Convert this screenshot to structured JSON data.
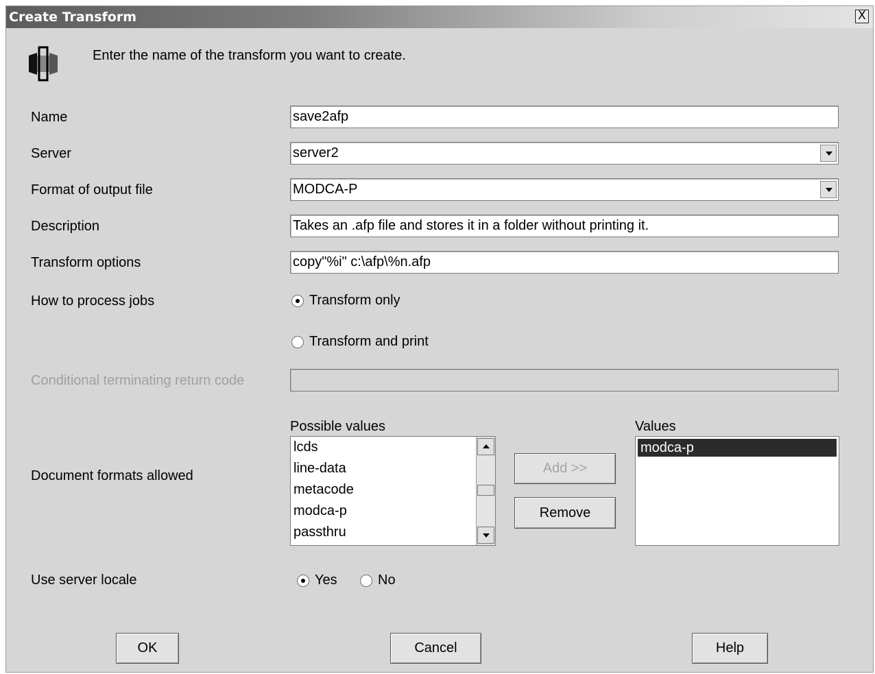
{
  "window": {
    "title": "Create Transform",
    "close_label": "X"
  },
  "intro": {
    "text": "Enter the name of the transform you want to create.",
    "icon": "transform-icon"
  },
  "form": {
    "name": {
      "label": "Name",
      "value": "save2afp"
    },
    "server": {
      "label": "Server",
      "value": "server2"
    },
    "format": {
      "label": "Format of output file",
      "value": "MODCA-P"
    },
    "description": {
      "label": "Description",
      "value": "Takes an .afp file and stores it in a folder without printing it."
    },
    "transform_options": {
      "label": "Transform options",
      "value": "copy\"%i\" c:\\afp\\%n.afp"
    },
    "process_jobs": {
      "label": "How to process jobs",
      "options": [
        {
          "label": "Transform only",
          "selected": true
        },
        {
          "label": "Transform and print",
          "selected": false
        }
      ]
    },
    "return_code": {
      "label": "Conditional terminating return code",
      "value": "",
      "disabled": true
    },
    "document_formats": {
      "label": "Document formats allowed",
      "possible_label": "Possible values",
      "possible_values": [
        "lcds",
        "line-data",
        "metacode",
        "modca-p",
        "passthru"
      ],
      "add_label": "Add >>",
      "remove_label": "Remove",
      "values_label": "Values",
      "values": [
        "modca-p"
      ]
    },
    "server_locale": {
      "label": "Use server locale",
      "options": [
        {
          "label": "Yes",
          "selected": true
        },
        {
          "label": "No",
          "selected": false
        }
      ]
    }
  },
  "buttons": {
    "ok": "OK",
    "cancel": "Cancel",
    "help": "Help"
  },
  "colors": {
    "dialog_bg": "#d6d6d6",
    "selection_bg": "#2b2b2b",
    "disabled_text": "#a0a0a0"
  }
}
